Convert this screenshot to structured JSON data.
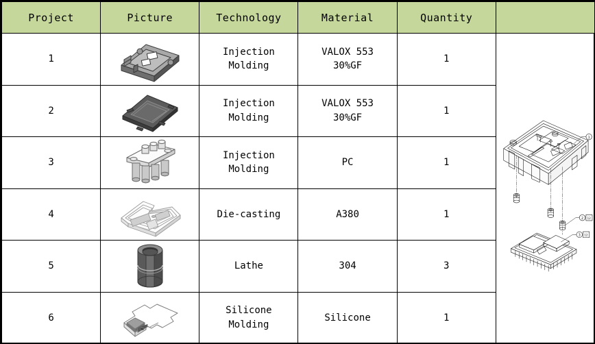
{
  "table": {
    "headers": [
      {
        "key": "project",
        "label": "Project"
      },
      {
        "key": "picture",
        "label": "Picture"
      },
      {
        "key": "technology",
        "label": "Technology"
      },
      {
        "key": "material",
        "label": "Material"
      },
      {
        "key": "quantity",
        "label": "Quantity"
      },
      {
        "key": "drawing",
        "label": ""
      }
    ],
    "rows": [
      {
        "project": "1",
        "picture_name": "injection-molded-housing-base",
        "technology_line1": "Injection",
        "technology_line2": "Molding",
        "material_line1": "VALOX 553",
        "material_line2": "30%GF",
        "quantity": "1"
      },
      {
        "project": "2",
        "picture_name": "injection-molded-cover-lid",
        "technology_line1": "Injection",
        "technology_line2": "Molding",
        "material_line1": "VALOX 553",
        "material_line2": "30%GF",
        "quantity": "1"
      },
      {
        "project": "3",
        "picture_name": "pc-connector-pin-block",
        "technology_line1": "Injection",
        "technology_line2": "Molding",
        "material_line1": "PC",
        "material_line2": "",
        "quantity": "1"
      },
      {
        "project": "4",
        "picture_name": "die-cast-frame-bracket",
        "technology_line1": "Die-casting",
        "technology_line2": "",
        "material_line1": "A380",
        "material_line2": "",
        "quantity": "1"
      },
      {
        "project": "5",
        "picture_name": "lathe-turned-bushing-sleeve",
        "technology_line1": "Lathe",
        "technology_line2": "",
        "material_line1": "304",
        "material_line2": "",
        "quantity": "3"
      },
      {
        "project": "6",
        "picture_name": "silicone-molded-gasket-sheet",
        "technology_line1": "Silicone",
        "technology_line2": "Molding",
        "material_line1": "Silicone",
        "material_line2": "",
        "quantity": "1"
      }
    ]
  },
  "drawing": {
    "title": "",
    "callouts": [
      {
        "id": "1",
        "label": "1",
        "box": ""
      },
      {
        "id": "2",
        "label": "2",
        "box": "12"
      },
      {
        "id": "3",
        "label": "3",
        "box": "12"
      }
    ]
  },
  "colors": {
    "header_fill": "#c5d79a",
    "border": "#000000",
    "part_gray_dark": "#4a4a4a",
    "part_gray_mid": "#8f8f8f",
    "part_gray_light": "#d8d8d8",
    "line": "#1a1a1a"
  }
}
